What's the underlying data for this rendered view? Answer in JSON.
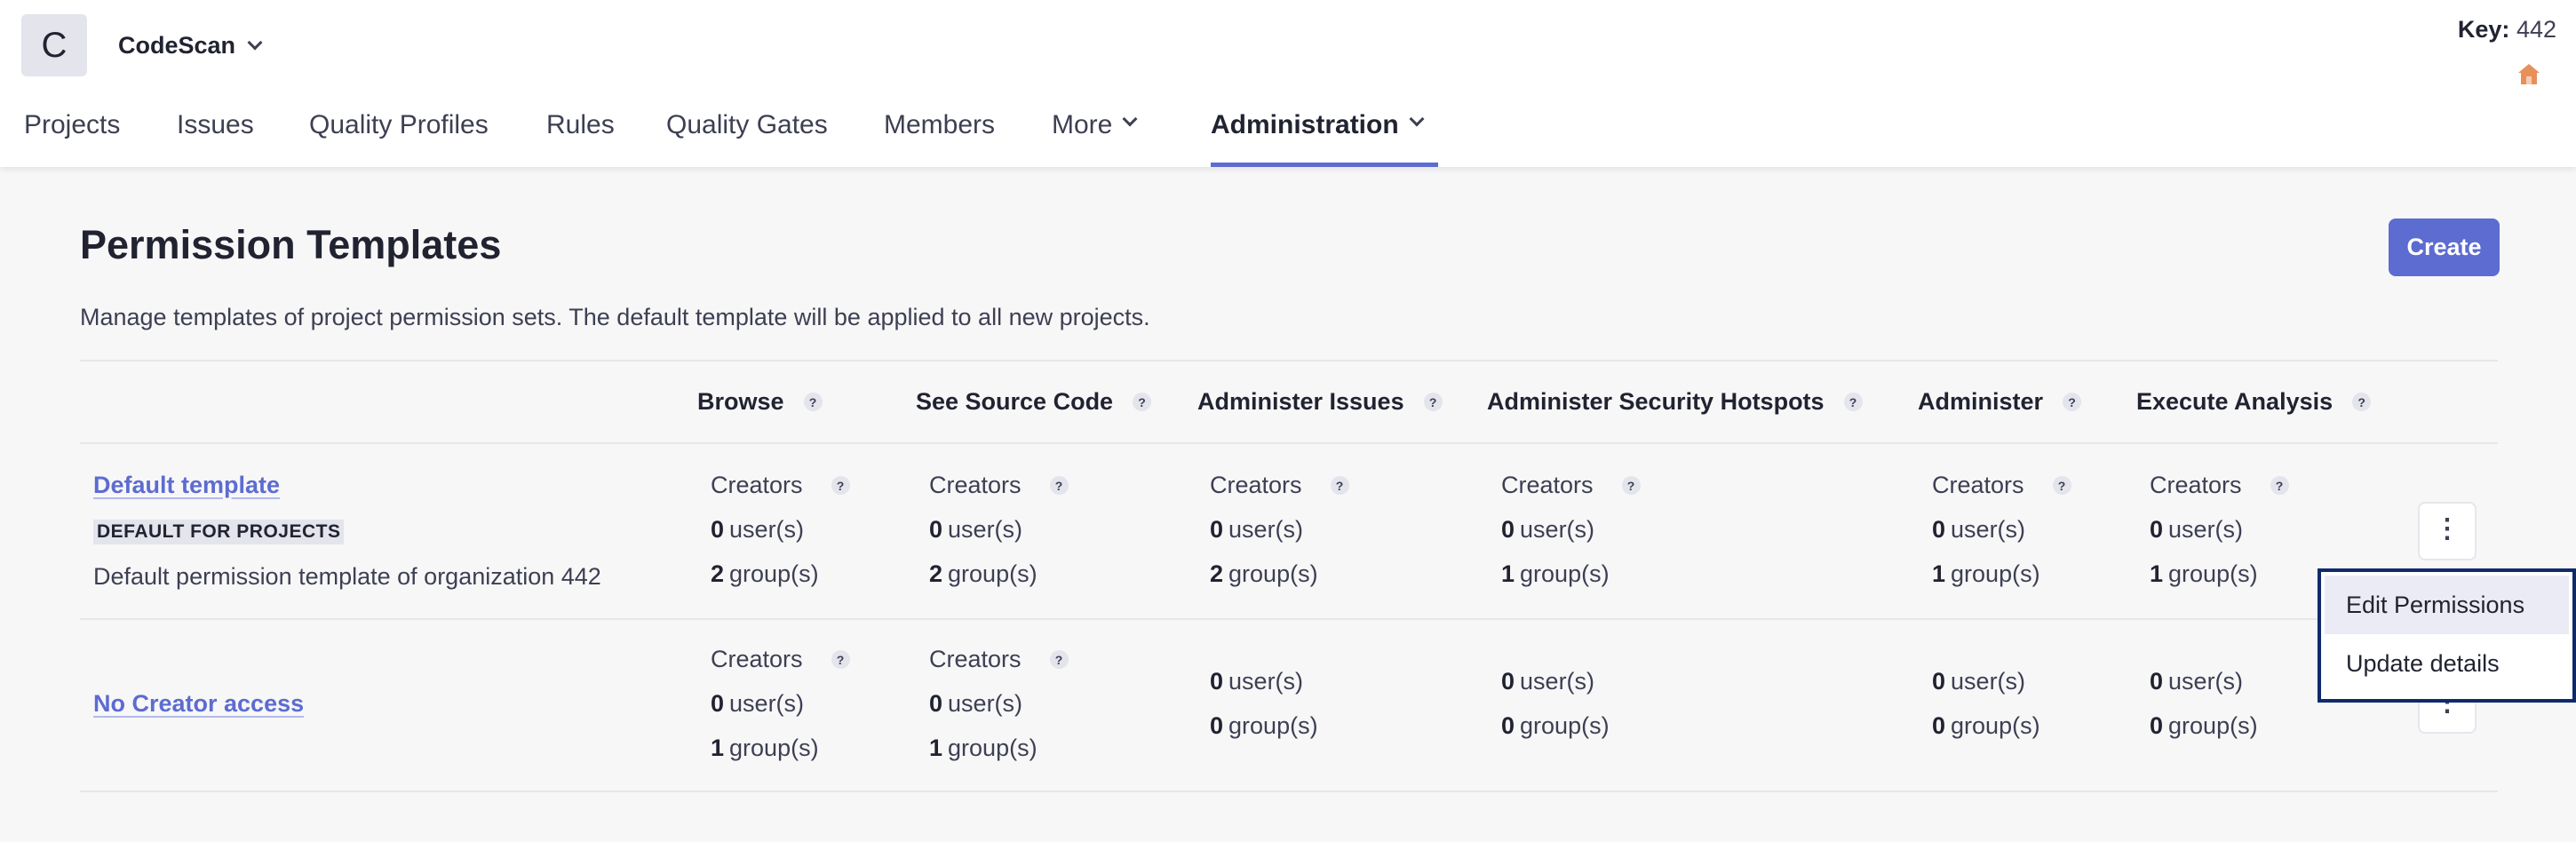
{
  "org": {
    "avatar_letter": "C",
    "name": "CodeScan"
  },
  "key": {
    "label": "Key:",
    "value": "442"
  },
  "nav": [
    {
      "label": "Projects"
    },
    {
      "label": "Issues"
    },
    {
      "label": "Quality Profiles"
    },
    {
      "label": "Rules"
    },
    {
      "label": "Quality Gates"
    },
    {
      "label": "Members"
    },
    {
      "label": "More"
    },
    {
      "label": "Administration"
    }
  ],
  "page": {
    "title": "Permission Templates",
    "create_label": "Create",
    "description": "Manage templates of project permission sets. The default template will be applied to all new projects."
  },
  "columns": [
    "Browse",
    "See Source Code",
    "Administer Issues",
    "Administer Security Hotspots",
    "Administer",
    "Execute Analysis"
  ],
  "help_glyph": "?",
  "templates": [
    {
      "name": "Default template",
      "badge": "DEFAULT FOR PROJECTS",
      "description": "Default permission template of organization 442",
      "cells": [
        {
          "creators": "Creators",
          "users_count": "0",
          "users_label": "user(s)",
          "groups_count": "2",
          "groups_label": "group(s)"
        },
        {
          "creators": "Creators",
          "users_count": "0",
          "users_label": "user(s)",
          "groups_count": "2",
          "groups_label": "group(s)"
        },
        {
          "creators": "Creators",
          "users_count": "0",
          "users_label": "user(s)",
          "groups_count": "2",
          "groups_label": "group(s)"
        },
        {
          "creators": "Creators",
          "users_count": "0",
          "users_label": "user(s)",
          "groups_count": "1",
          "groups_label": "group(s)"
        },
        {
          "creators": "Creators",
          "users_count": "0",
          "users_label": "user(s)",
          "groups_count": "1",
          "groups_label": "group(s)"
        },
        {
          "creators": "Creators",
          "users_count": "0",
          "users_label": "user(s)",
          "groups_count": "1",
          "groups_label": "group(s)"
        }
      ]
    },
    {
      "name": "No Creator access",
      "cells": [
        {
          "creators": "Creators",
          "users_count": "0",
          "users_label": "user(s)",
          "groups_count": "1",
          "groups_label": "group(s)"
        },
        {
          "creators": "Creators",
          "users_count": "0",
          "users_label": "user(s)",
          "groups_count": "1",
          "groups_label": "group(s)"
        },
        {
          "users_count": "0",
          "users_label": "user(s)",
          "groups_count": "0",
          "groups_label": "group(s)"
        },
        {
          "users_count": "0",
          "users_label": "user(s)",
          "groups_count": "0",
          "groups_label": "group(s)"
        },
        {
          "users_count": "0",
          "users_label": "user(s)",
          "groups_count": "0",
          "groups_label": "group(s)"
        },
        {
          "users_count": "0",
          "users_label": "user(s)",
          "groups_count": "0",
          "groups_label": "group(s)"
        }
      ]
    }
  ],
  "menu": {
    "items": [
      "Edit Permissions",
      "Update details"
    ]
  },
  "actions_glyph": "⋮",
  "colors": {
    "accent": "#5d6cd0",
    "home_icon": "#e8905a",
    "menu_border": "#0f2a6b"
  }
}
